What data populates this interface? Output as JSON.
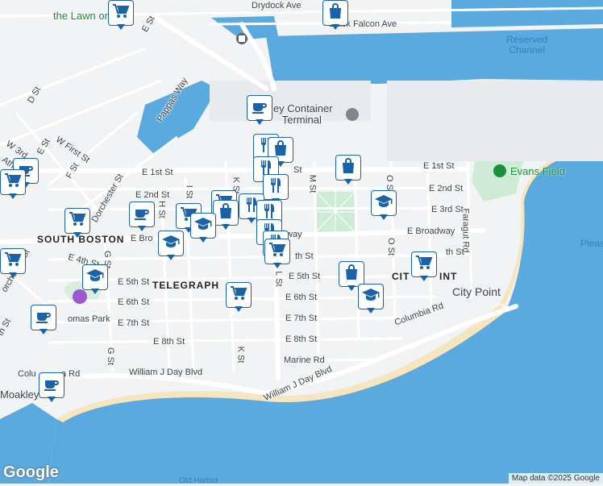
{
  "map": {
    "colors": {
      "land": "#f1f3f4",
      "water": "#5aaadf",
      "park": "#cdebd5",
      "road": "#ffffff",
      "sand": "#f6e6c0",
      "marker": "#1a63a8"
    },
    "labels": {
      "drydock_ave": "Drydock Ave",
      "black_falcon_ave": "Black Falcon Ave",
      "reserved_channel": "Reserved\nChannel",
      "lawn_on_d": "the Lawn on D",
      "pappas_way": "Pappas Way",
      "d_st": "D St",
      "e_st_top": "E St",
      "w_first_st": "W First St",
      "w_3rd": "W 3rd",
      "f_st": "F St",
      "e_st_left": "E St",
      "ath": "Ath",
      "container_terminal": "ley Container\nTerminal",
      "e_1st_st_left": "E 1st St",
      "e_1st_st_mid": "St",
      "e_1st_st_right": "E 1st St",
      "evans_field": "Evans Field",
      "o_st_upper": "O St",
      "m_st": "M St",
      "e_2nd_st_left": "E 2nd St",
      "e_2nd_st_right": "E 2nd St",
      "i_st": "I St",
      "h_st": "H St",
      "k_st_upper": "K St",
      "e_3rd_st": "E 3rd St",
      "dorchester_st_upper": "Dorchester St",
      "south_boston": "SOUTH BOSTON",
      "e_broadway_left": "E Bro",
      "e_broadway_mid": "way",
      "e_broadway_right": "E Broadway",
      "faragut_rd": "Faragut Rd",
      "o_st_lower": "O St",
      "e_4th_st": "E 4th St",
      "th_st_mid": "th St",
      "th_st_right": "th St",
      "orchester_st": "orchester St",
      "g_st_upper": "G St",
      "e_5th_st_left": "E 5th St",
      "telegraph": "TELEGRAPH",
      "l_st": "L St",
      "e_5th_st_right": "E 5th St",
      "city_point_hood": "CIT",
      "city_point_hood2": "INT",
      "city_point": "City Point",
      "e_6th_st_left": "E 6th St",
      "e_6th_st_right": "E 6th St",
      "omas_park": "omas Park",
      "e_7th_st_left": "E 7th St",
      "e_7th_st_right": "E 7th St",
      "th_st_far_left": "th St",
      "columbia_rd_right": "Columbia Rd",
      "e_8th_st_left": "E 8th St",
      "e_8th_st_right": "E 8th St",
      "g_st_lower": "G St",
      "k_st_lower": "K St",
      "marine_rd": "Marine Rd",
      "william_j_day_blvd_left": "William J Day Blvd",
      "william_j_day_blvd_right": "William J Day Blvd",
      "columbia_rd_left": "Colu",
      "columbia_rd_left2": "a Rd",
      "moakley": "Moakley",
      "pleas": "Pleas",
      "old_harbor": "Old Harbor"
    },
    "markers": [
      {
        "icon": "cafe-icon"
      },
      {
        "icon": "grocery-icon"
      },
      {
        "icon": "restaurant-icon"
      },
      {
        "icon": "shopping-icon"
      },
      {
        "icon": "restaurant-icon"
      },
      {
        "icon": "shopping-icon"
      },
      {
        "icon": "restaurant-icon"
      },
      {
        "icon": "school-icon"
      },
      {
        "icon": "cafe-icon"
      },
      {
        "icon": "cafe-icon"
      },
      {
        "icon": "grocery-icon"
      },
      {
        "icon": "grocery-icon"
      },
      {
        "icon": "grocery-icon"
      },
      {
        "icon": "shopping-icon"
      },
      {
        "icon": "restaurant-icon"
      },
      {
        "icon": "school-icon"
      },
      {
        "icon": "restaurant-icon"
      },
      {
        "icon": "school-icon"
      },
      {
        "icon": "restaurant-icon"
      },
      {
        "icon": "restaurant-icon"
      },
      {
        "icon": "grocery-icon"
      },
      {
        "icon": "school-icon"
      },
      {
        "icon": "shopping-icon"
      },
      {
        "icon": "school-icon"
      },
      {
        "icon": "grocery-icon"
      },
      {
        "icon": "grocery-icon"
      },
      {
        "icon": "cafe-icon"
      },
      {
        "icon": "grocery-icon"
      },
      {
        "icon": "grocery-icon"
      },
      {
        "icon": "shopping-icon"
      },
      {
        "icon": "cafe-icon"
      }
    ],
    "google_logo": "Google",
    "attribution": "Map data ©2025 Google"
  }
}
